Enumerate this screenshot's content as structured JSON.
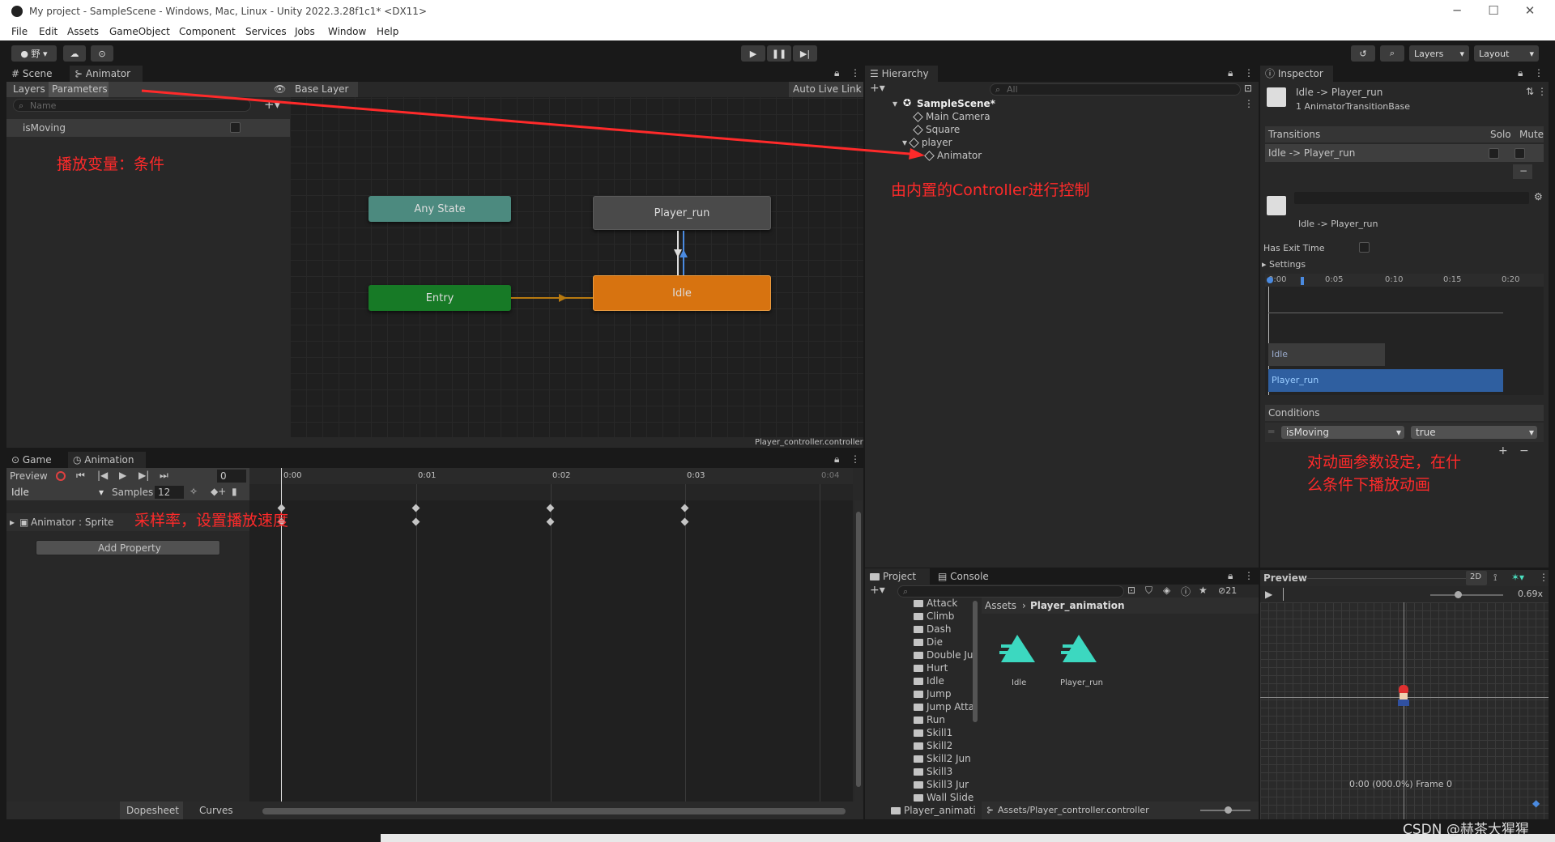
{
  "window": {
    "title": "My project - SampleScene - Windows, Mac, Linux - Unity 2022.3.28f1c1* <DX11>"
  },
  "menu": [
    "File",
    "Edit",
    "Assets",
    "GameObject",
    "Component",
    "Services",
    "Jobs",
    "Window",
    "Help"
  ],
  "toolbar": {
    "account": "野",
    "layers": "Layers",
    "layout": "Layout"
  },
  "scene_tabs": {
    "scene": "Scene",
    "animator": "Animator"
  },
  "animator": {
    "tab_layers": "Layers",
    "tab_parameters": "Parameters",
    "search_placeholder": "Name",
    "parameter": "isMoving",
    "breadcrumb": "Base Layer",
    "auto_live_link": "Auto Live Link",
    "controller_file": "Player_controller.controller",
    "nodes": {
      "any_state": "Any State",
      "player_run": "Player_run",
      "entry": "Entry",
      "idle": "Idle"
    }
  },
  "hierarchy": {
    "tab": "Hierarchy",
    "search_placeholder": "All",
    "scene": "SampleScene*",
    "items": [
      "Main Camera",
      "Square",
      "player",
      "Animator"
    ]
  },
  "inspector": {
    "tab": "Inspector",
    "title": "Idle -> Player_run",
    "subtitle": "1 AnimatorTransitionBase",
    "transitions_label": "Transitions",
    "solo": "Solo",
    "mute": "Mute",
    "transition_item": "Idle -> Player_run",
    "transition_name": "Idle -> Player_run",
    "has_exit_time": "Has Exit Time",
    "settings": "Settings",
    "timeline_ticks": [
      "0:00",
      "0:05",
      "0:10",
      "0:15",
      "0:20"
    ],
    "bar_idle": "Idle",
    "bar_run": "Player_run",
    "conditions_label": "Conditions",
    "condition_param": "isMoving",
    "condition_value": "true"
  },
  "animation": {
    "tab_game": "Game",
    "tab_animation": "Animation",
    "preview": "Preview",
    "frame": "0",
    "clip": "Idle",
    "samples_label": "Samples",
    "samples_value": "12",
    "property": "Animator : Sprite",
    "add_property": "Add Property",
    "dopesheet": "Dopesheet",
    "curves": "Curves",
    "ticks": [
      "0:00",
      "0:01",
      "0:02",
      "0:03",
      "0:04"
    ]
  },
  "project": {
    "tab_project": "Project",
    "tab_console": "Console",
    "hidden_count": "21",
    "folders": [
      "Attack",
      "Climb",
      "Dash",
      "Die",
      "Double Ju",
      "Hurt",
      "Idle",
      "Jump",
      "Jump Atta",
      "Run",
      "Skill1",
      "Skill2",
      "Skill2 Jun",
      "Skill3",
      "Skill3 Jur",
      "Wall Slide",
      "Player_animati"
    ],
    "breadcrumb_root": "Assets",
    "breadcrumb_current": "Player_animation",
    "assets": [
      "Idle",
      "Player_run"
    ],
    "path": "Assets/Player_controller.controller"
  },
  "preview": {
    "label": "Preview",
    "mode": "2D",
    "speed": "0.69x",
    "frame_info": "0:00 (000.0%) Frame 0"
  },
  "annotations": {
    "params": "播放变量：条件",
    "controller": "由内置的Controller进行控制",
    "sample_rate": "采样率，设置播放速度",
    "conditions_line1": "对动画参数设定，在什",
    "conditions_line2": "么条件下播放动画"
  },
  "watermark": "CSDN @赫茶大猩猩",
  "colors": {
    "accent_red": "#ff2a2a",
    "idle_node": "#d77310",
    "entry_node": "#177a26",
    "any_state_node": "#4c8a7f",
    "run_bar": "#2f5fa0"
  }
}
